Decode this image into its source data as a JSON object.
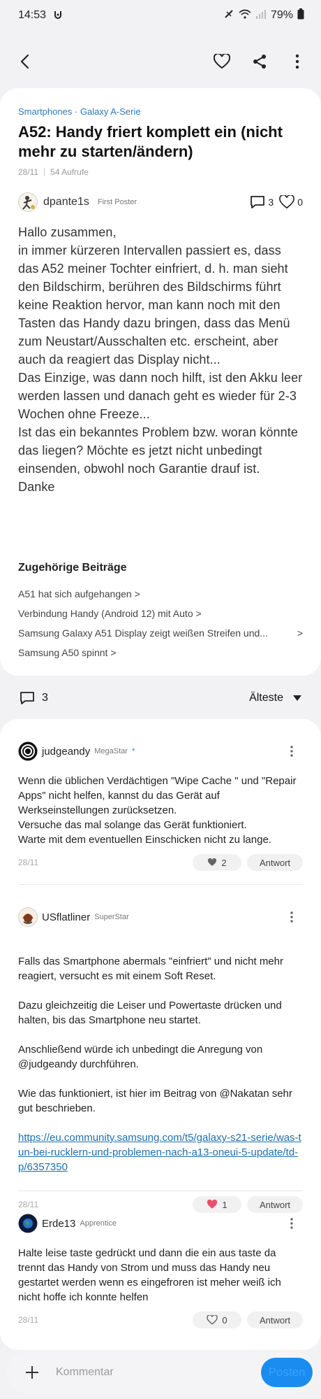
{
  "status_bar": {
    "time": "14:53",
    "battery": "79%"
  },
  "post": {
    "breadcrumb": "Smartphones · Galaxy A-Serie",
    "title": "A52: Handy friert komplett ein (nicht mehr zu starten/ändern)",
    "date": "28/11",
    "views": "54 Aufrufe",
    "author": "dpante1s",
    "author_rank": "First Poster",
    "comment_count": "3",
    "like_count": "0",
    "body": "Hallo zusammen,\nin immer kürzeren Intervallen passiert es, dass das A52 meiner Tochter einfriert, d. h. man sieht den Bildschirm, berühren des Bildschirms führt keine Reaktion hervor, man kann noch mit den Tasten das Handy dazu bringen, dass das Menü zum Neustart/Ausschalten etc. erscheint, aber auch da reagiert das Display nicht...\nDas Einzige, was dann noch hilft, ist den Akku leer werden lassen und danach geht es wieder für 2-3 Wochen ohne Freeze...\nIst das ein bekanntes Problem bzw. woran könnte das liegen? Möchte es jetzt nicht unbedingt einsenden, obwohl noch Garantie drauf ist.\nDanke"
  },
  "related": {
    "title": "Zugehörige Beiträge",
    "items": [
      {
        "label": "A51 hat sich aufgehangen",
        "arrow": ">"
      },
      {
        "label": "Verbindung Handy (Android 12) mit Auto",
        "arrow": ">"
      },
      {
        "label": "Samsung Galaxy A51 Display zeigt weißen Streifen und...",
        "arrow": ">"
      },
      {
        "label": "Samsung A50 spinnt",
        "arrow": ">"
      }
    ]
  },
  "sort_bar": {
    "comment_count": "3",
    "sort_label": "Älteste"
  },
  "comments": [
    {
      "user": "judgeandy",
      "rank": "MegaStar",
      "star": "*",
      "body": "Wenn die üblichen Verdächtigen \"Wipe Cache \" und \"Repair Apps\" nicht helfen, kannst du das Gerät auf Werkseinstellungen zurücksetzen.\nVersuche das mal solange das Gerät funktioniert.\nWarte mit dem eventuellen Einschicken nicht zu lange.",
      "link": "",
      "date": "28/11",
      "likes": "2",
      "answer": "Antwort"
    },
    {
      "user": "USflatliner",
      "rank": "SuperStar",
      "star": "",
      "body": "Falls das Smartphone abermals \"einfriert\" und nicht mehr reagiert, versucht es mit einem Soft Reset.\n\nDazu gleichzeitig die Leiser und Powertaste drücken und halten, bis das Smartphone neu startet.\n\nAnschließend würde ich unbedingt die Anregung von @judgeandy durchführen.\n\nWie das funktioniert, ist hier im Beitrag von @Nakatan sehr gut beschrieben.",
      "link": "https://eu.community.samsung.com/t5/galaxy-s21-serie/was-tun-bei-rucklern-und-problemen-nach-a13-oneui-5-update/td-p/6357350",
      "date": "28/11",
      "likes": "1",
      "answer": "Antwort"
    },
    {
      "user": "Erde13",
      "rank": "Apprentice",
      "star": "",
      "body": "Halte leise taste gedrückt und dann die ein aus taste da trennt das Handy von Strom und muss das Handy neu gestartet werden wenn es eingefroren ist meher weiß ich nicht hoffe ich konnte helfen",
      "link": "",
      "date": "28/11",
      "likes": "0",
      "answer": "Antwort"
    }
  ],
  "bottom_bar": {
    "placeholder": "Kommentar",
    "post_label": "Posten"
  },
  "colors": {
    "accent": "#1a8cf0",
    "link": "#1f6fae",
    "breadcrumb": "#2b7bb9",
    "liked": "#e8506a"
  }
}
